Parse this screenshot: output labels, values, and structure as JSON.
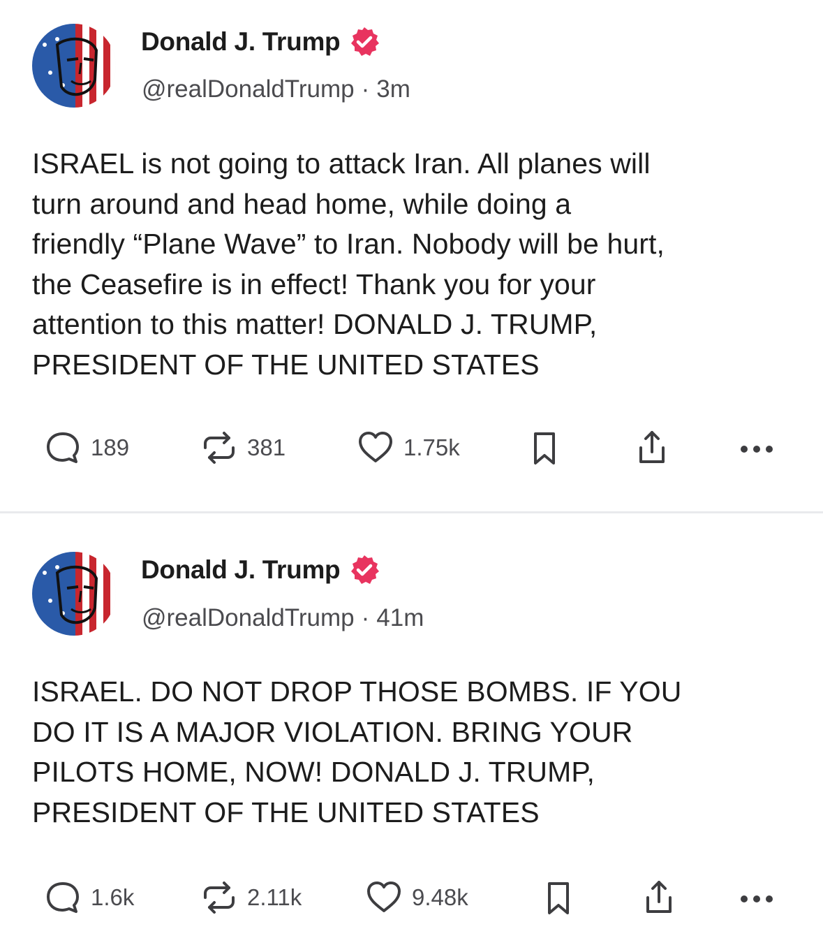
{
  "posts": [
    {
      "author": {
        "display_name": "Donald J. Trump",
        "handle": "@realDonaldTrump",
        "separator": "·",
        "time": "3m",
        "verified_icon": "verified-badge-icon",
        "verified_color": "#e8345f"
      },
      "text": "ISRAEL is not going to attack Iran. All planes will\nturn around and head home, while doing a\nfriendly “Plane Wave” to Iran. Nobody will be hurt,\nthe Ceasefire is in effect! Thank you for your\nattention to this matter! DONALD J. TRUMP,\nPRESIDENT OF THE UNITED STATES",
      "actions": {
        "replies": "189",
        "reposts": "381",
        "likes": "1.75k"
      }
    },
    {
      "author": {
        "display_name": "Donald J. Trump",
        "handle": "@realDonaldTrump",
        "separator": "·",
        "time": "41m",
        "verified_icon": "verified-badge-icon",
        "verified_color": "#e8345f"
      },
      "text": "ISRAEL. DO NOT DROP THOSE BOMBS. IF YOU\nDO IT IS A MAJOR VIOLATION. BRING YOUR\nPILOTS HOME, NOW!  DONALD J. TRUMP,\nPRESIDENT OF THE UNITED STATES",
      "actions": {
        "replies": "1.6k",
        "reposts": "2.11k",
        "likes": "9.48k"
      }
    }
  ],
  "icons": {
    "reply": "reply-icon",
    "repost": "repost-icon",
    "like": "heart-icon",
    "bookmark": "bookmark-icon",
    "share": "share-icon",
    "more": "more-icon"
  },
  "colors": {
    "background": "#ffffff",
    "text": "#1c1c1c",
    "muted": "#4b4b4f",
    "accent": "#e8345f",
    "divider": "#e9eaed"
  }
}
